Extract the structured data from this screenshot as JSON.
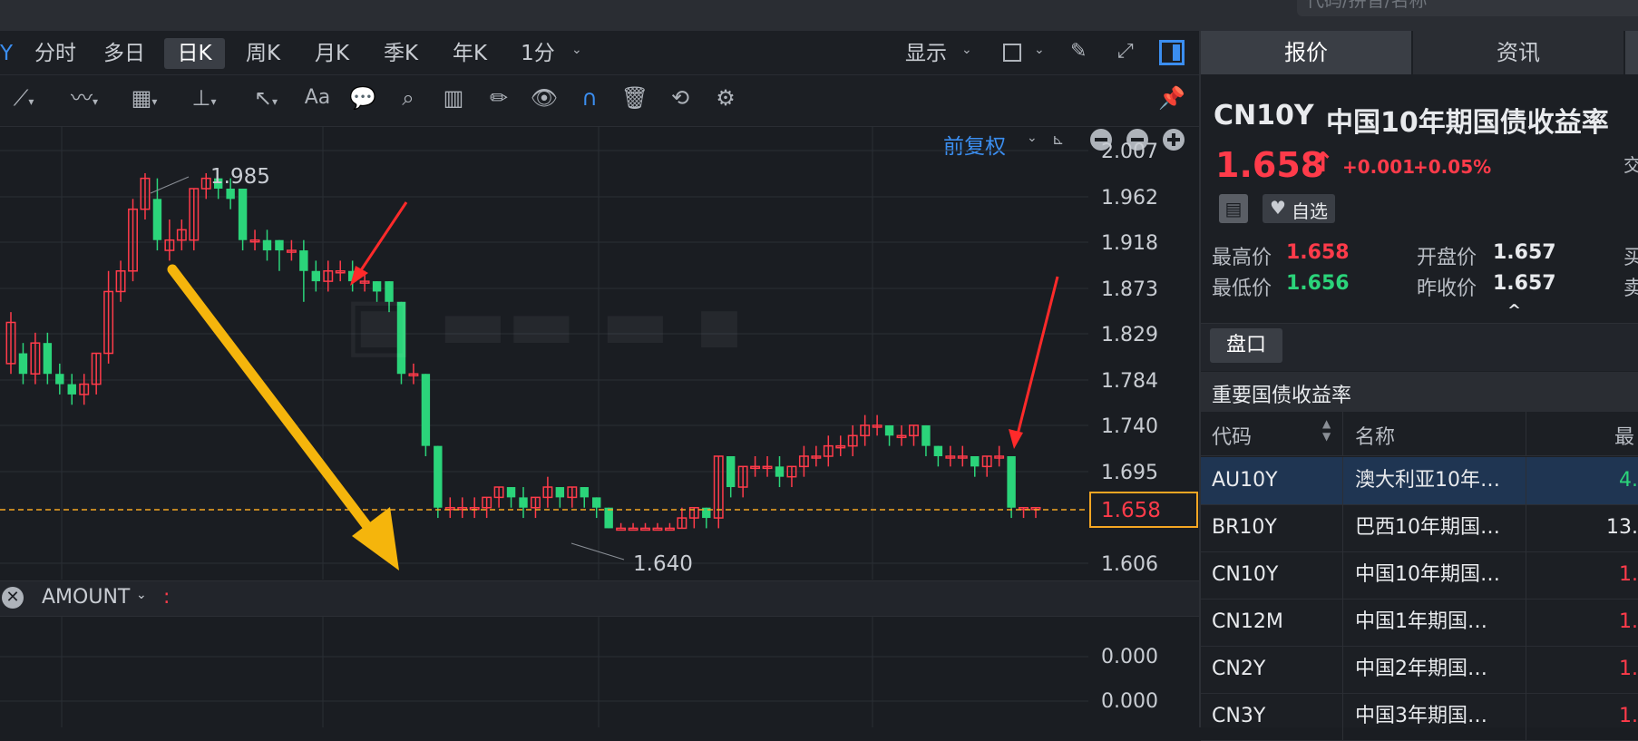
{
  "top": {
    "search_placeholder": "代码/拼音/名称"
  },
  "periods": {
    "y_partial": "Y",
    "items": [
      "分时",
      "多日",
      "日K",
      "周K",
      "月K",
      "季K",
      "年K",
      "1分"
    ],
    "active": "日K"
  },
  "toolbar_right": {
    "display_label": "显示"
  },
  "chart_header": {
    "adjust_label": "前复权"
  },
  "price_axis": [
    "2.007",
    "1.962",
    "1.918",
    "1.873",
    "1.829",
    "1.784",
    "1.740",
    "1.695",
    "1.606"
  ],
  "current_price_tag": "1.658",
  "annotations": {
    "high_label": "1.985",
    "low_label": "1.640"
  },
  "amount_indicator": {
    "label": "AMOUNT",
    "colon": ":"
  },
  "volume_axis": [
    "0.000",
    "0.000"
  ],
  "colors": {
    "up": "#ff3b4a",
    "down": "#2bd47a",
    "accent": "#3b8ef0",
    "arrow_yellow": "#f5b50c",
    "arrow_red": "#ff2a2a"
  },
  "chart_data": {
    "type": "candlestick",
    "ylim": [
      1.606,
      2.007
    ],
    "price_line": 1.658,
    "candles": [
      [
        1.8,
        1.84,
        1.79,
        1.85
      ],
      [
        1.81,
        1.79,
        1.78,
        1.82
      ],
      [
        1.79,
        1.82,
        1.78,
        1.83
      ],
      [
        1.82,
        1.79,
        1.78,
        1.83
      ],
      [
        1.79,
        1.78,
        1.77,
        1.8
      ],
      [
        1.78,
        1.77,
        1.76,
        1.79
      ],
      [
        1.77,
        1.78,
        1.76,
        1.79
      ],
      [
        1.78,
        1.81,
        1.77,
        1.81
      ],
      [
        1.81,
        1.87,
        1.8,
        1.89
      ],
      [
        1.87,
        1.89,
        1.86,
        1.9
      ],
      [
        1.89,
        1.95,
        1.88,
        1.96
      ],
      [
        1.95,
        1.98,
        1.94,
        1.985
      ],
      [
        1.96,
        1.92,
        1.91,
        1.98
      ],
      [
        1.91,
        1.92,
        1.9,
        1.94
      ],
      [
        1.92,
        1.93,
        1.91,
        1.94
      ],
      [
        1.92,
        1.97,
        1.91,
        1.97
      ],
      [
        1.97,
        1.98,
        1.96,
        1.985
      ],
      [
        1.98,
        1.97,
        1.96,
        1.98
      ],
      [
        1.97,
        1.96,
        1.95,
        1.98
      ],
      [
        1.97,
        1.92,
        1.91,
        1.97
      ],
      [
        1.92,
        1.92,
        1.91,
        1.93
      ],
      [
        1.92,
        1.91,
        1.9,
        1.93
      ],
      [
        1.92,
        1.91,
        1.89,
        1.92
      ],
      [
        1.91,
        1.91,
        1.9,
        1.92
      ],
      [
        1.91,
        1.89,
        1.86,
        1.92
      ],
      [
        1.89,
        1.88,
        1.87,
        1.9
      ],
      [
        1.88,
        1.89,
        1.87,
        1.9
      ],
      [
        1.89,
        1.89,
        1.88,
        1.9
      ],
      [
        1.89,
        1.88,
        1.87,
        1.9
      ],
      [
        1.88,
        1.88,
        1.87,
        1.89
      ],
      [
        1.88,
        1.87,
        1.86,
        1.88
      ],
      [
        1.88,
        1.86,
        1.85,
        1.88
      ],
      [
        1.86,
        1.79,
        1.78,
        1.86
      ],
      [
        1.79,
        1.79,
        1.78,
        1.8
      ],
      [
        1.79,
        1.72,
        1.71,
        1.79
      ],
      [
        1.72,
        1.66,
        1.65,
        1.72
      ],
      [
        1.66,
        1.66,
        1.65,
        1.67
      ],
      [
        1.66,
        1.66,
        1.65,
        1.67
      ],
      [
        1.66,
        1.66,
        1.65,
        1.67
      ],
      [
        1.66,
        1.67,
        1.65,
        1.67
      ],
      [
        1.67,
        1.68,
        1.66,
        1.68
      ],
      [
        1.68,
        1.67,
        1.66,
        1.68
      ],
      [
        1.67,
        1.66,
        1.65,
        1.68
      ],
      [
        1.66,
        1.67,
        1.65,
        1.67
      ],
      [
        1.67,
        1.68,
        1.66,
        1.69
      ],
      [
        1.68,
        1.67,
        1.66,
        1.68
      ],
      [
        1.67,
        1.68,
        1.66,
        1.68
      ],
      [
        1.68,
        1.67,
        1.66,
        1.68
      ],
      [
        1.67,
        1.66,
        1.65,
        1.67
      ],
      [
        1.66,
        1.64,
        1.64,
        1.66
      ],
      [
        1.64,
        1.64,
        1.64,
        1.645
      ],
      [
        1.64,
        1.64,
        1.64,
        1.645
      ],
      [
        1.64,
        1.64,
        1.64,
        1.645
      ],
      [
        1.64,
        1.64,
        1.64,
        1.645
      ],
      [
        1.64,
        1.64,
        1.64,
        1.645
      ],
      [
        1.64,
        1.65,
        1.64,
        1.66
      ],
      [
        1.65,
        1.66,
        1.64,
        1.66
      ],
      [
        1.66,
        1.65,
        1.64,
        1.66
      ],
      [
        1.65,
        1.71,
        1.64,
        1.71
      ],
      [
        1.71,
        1.68,
        1.67,
        1.71
      ],
      [
        1.68,
        1.7,
        1.67,
        1.7
      ],
      [
        1.7,
        1.7,
        1.69,
        1.71
      ],
      [
        1.7,
        1.7,
        1.69,
        1.71
      ],
      [
        1.7,
        1.69,
        1.68,
        1.71
      ],
      [
        1.69,
        1.7,
        1.68,
        1.7
      ],
      [
        1.7,
        1.71,
        1.69,
        1.72
      ],
      [
        1.71,
        1.71,
        1.7,
        1.72
      ],
      [
        1.71,
        1.72,
        1.7,
        1.73
      ],
      [
        1.72,
        1.72,
        1.71,
        1.73
      ],
      [
        1.72,
        1.73,
        1.71,
        1.74
      ],
      [
        1.73,
        1.74,
        1.72,
        1.75
      ],
      [
        1.74,
        1.74,
        1.73,
        1.75
      ],
      [
        1.74,
        1.73,
        1.72,
        1.74
      ],
      [
        1.73,
        1.73,
        1.72,
        1.74
      ],
      [
        1.73,
        1.74,
        1.72,
        1.74
      ],
      [
        1.74,
        1.72,
        1.71,
        1.74
      ],
      [
        1.72,
        1.71,
        1.7,
        1.72
      ],
      [
        1.71,
        1.71,
        1.7,
        1.72
      ],
      [
        1.71,
        1.71,
        1.7,
        1.72
      ],
      [
        1.71,
        1.7,
        1.69,
        1.71
      ],
      [
        1.7,
        1.71,
        1.69,
        1.71
      ],
      [
        1.71,
        1.71,
        1.7,
        1.72
      ],
      [
        1.71,
        1.66,
        1.65,
        1.71
      ],
      [
        1.66,
        1.66,
        1.65,
        1.66
      ],
      [
        1.66,
        1.66,
        1.65,
        1.66
      ]
    ]
  },
  "quote": {
    "tabs": [
      "报价",
      "资讯"
    ],
    "code": "CN10Y",
    "name": "中国10年期国债收益率",
    "price": "1.658",
    "arrow": "↑",
    "change": "+0.001",
    "change_pct": "+0.05%",
    "side_partial": "交",
    "watch_label": "自选",
    "high_label": "最高价",
    "high": "1.658",
    "low_label": "最低价",
    "low": "1.656",
    "open_label": "开盘价",
    "open": "1.657",
    "prev_label": "昨收价",
    "prev": "1.657",
    "buy_partial": "买",
    "sell_partial": "卖",
    "caret": "^"
  },
  "panel": {
    "pankou_label": "盘口",
    "section_title": "重要国债收益率",
    "columns": [
      "代码",
      "名称",
      "最"
    ],
    "rows": [
      {
        "code": "AU10Y",
        "name": "澳大利亚10年…",
        "value": "4.",
        "color": "#2bd47a"
      },
      {
        "code": "BR10Y",
        "name": "巴西10年期国…",
        "value": "13.",
        "color": "#e8eaed"
      },
      {
        "code": "CN10Y",
        "name": "中国10年期国…",
        "value": "1.",
        "color": "#ff3b4a"
      },
      {
        "code": "CN12M",
        "name": "中国1年期国…",
        "value": "1.",
        "color": "#ff3b4a"
      },
      {
        "code": "CN2Y",
        "name": "中国2年期国…",
        "value": "1.",
        "color": "#ff3b4a"
      },
      {
        "code": "CN3Y",
        "name": "中国3年期国…",
        "value": "1.",
        "color": "#ff3b4a"
      }
    ]
  }
}
